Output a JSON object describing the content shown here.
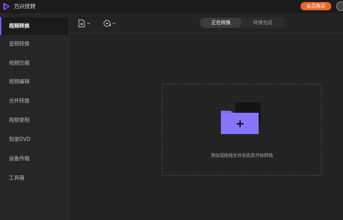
{
  "app": {
    "title": "万兴优转",
    "vip_label": "会员购买"
  },
  "sidebar": {
    "items": [
      {
        "label": "视频转换",
        "active": true
      },
      {
        "label": "音频转换"
      },
      {
        "label": "视频压缩"
      },
      {
        "label": "视频编辑"
      },
      {
        "label": "合并转换"
      },
      {
        "label": "视频录制"
      },
      {
        "label": "刻录DVD"
      },
      {
        "label": "设备传输"
      },
      {
        "label": "工具箱"
      }
    ]
  },
  "toolbar": {
    "add_file_icon": "add-file-icon",
    "add_media_icon": "add-media-icon"
  },
  "tabs": [
    {
      "label": "正在转换",
      "active": true
    },
    {
      "label": "转换完成"
    }
  ],
  "dropzone": {
    "hint": "添加或拖拽文件到此处开始转换"
  },
  "colors": {
    "accent": "#7b5cff",
    "vip": "#e8652c",
    "folder": "#7b6cf5"
  }
}
